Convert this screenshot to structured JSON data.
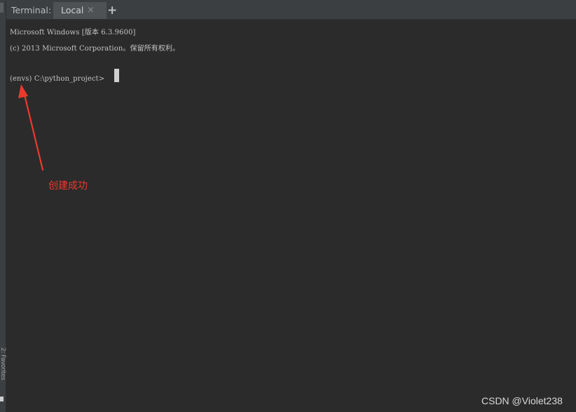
{
  "tool_window": {
    "title": "Terminal:",
    "tabs": [
      {
        "label": "Local",
        "close_icon": "×"
      }
    ],
    "add_tab_icon": "+"
  },
  "side_strip": {
    "label": "2: Favorites"
  },
  "terminal": {
    "lines": [
      "Microsoft Windows [版本 6.3.9600]",
      "(c) 2013 Microsoft Corporation。保留所有权利。",
      "(envs) C:\\python_project>"
    ]
  },
  "annotation": {
    "text": "创建成功",
    "color": "#ea3a2e"
  },
  "watermark": "CSDN @Violet238"
}
